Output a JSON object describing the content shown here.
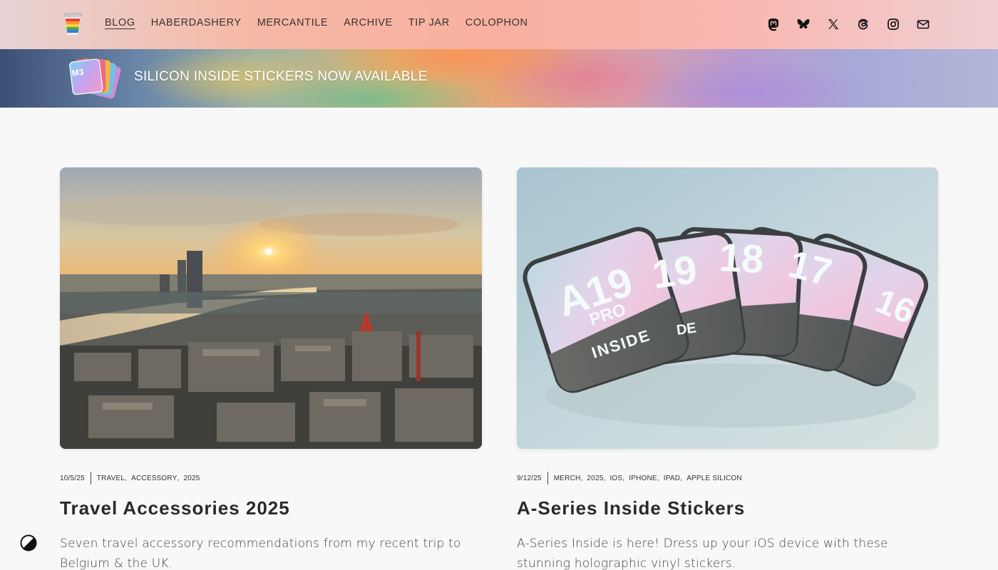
{
  "header": {
    "logo_icon": "cup-icon",
    "nav": [
      {
        "label": "BLOG",
        "active": true
      },
      {
        "label": "HABERDASHERY",
        "active": false
      },
      {
        "label": "MERCANTILE",
        "active": false
      },
      {
        "label": "ARCHIVE",
        "active": false
      },
      {
        "label": "TIP JAR",
        "active": false
      },
      {
        "label": "COLOPHON",
        "active": false
      }
    ],
    "socials": [
      "mastodon-icon",
      "bluesky-icon",
      "x-icon",
      "threads-icon",
      "instagram-icon",
      "mail-icon"
    ]
  },
  "banner": {
    "text": "SILICON INSIDE STICKERS NOW AVAILABLE",
    "art_label": "M3"
  },
  "posts": [
    {
      "date": "10/5/25",
      "tags": [
        "TRAVEL",
        "ACCESSORY",
        "2025"
      ],
      "title": "Travel Accessories 2025",
      "excerpt": "Seven travel accessory recommendations from my recent trip to Belgium & the UK."
    },
    {
      "date": "9/12/25",
      "tags": [
        "MERCH",
        "2025",
        "IOS",
        "IPHONE",
        "IPAD",
        "APPLE SILICON"
      ],
      "title": "A-Series Inside Stickers",
      "excerpt": "A-Series Inside is here! Dress up your iOS device with these stunning holographic vinyl stickers.",
      "image_labels": [
        "A19",
        "PRO",
        "INSIDE",
        "19",
        "18",
        "17",
        "16",
        "DE"
      ]
    }
  ],
  "colors": {
    "header_gradient": [
      "#e8d3d4",
      "#f9b0a0",
      "#f1cfd3"
    ],
    "text": "#2b2b2b",
    "background": "#f8f8f8"
  }
}
